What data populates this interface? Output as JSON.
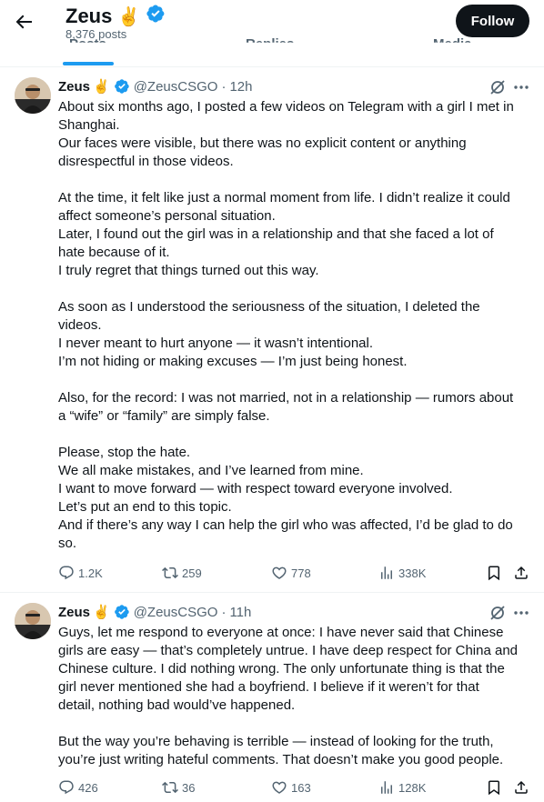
{
  "header": {
    "name": "Zeus",
    "name_emoji": "✌️",
    "posts_count": "8,376 posts",
    "follow_label": "Follow",
    "tabs": [
      "Posts",
      "Replies",
      "Media"
    ]
  },
  "tweets": [
    {
      "name": "Zeus",
      "emoji": "✌️",
      "handle": "@ZeusCSGO",
      "time": "12h",
      "lines": [
        "About six months ago, I posted a few videos on Telegram with a girl I met in",
        "Shanghai.",
        "Our faces were visible, but there was no explicit content or anything",
        "disrespectful in those videos.",
        "",
        "At the time, it felt like just a normal moment from life. I didn’t realize it could",
        "affect someone’s personal situation.",
        "Later, I found out the girl was in a relationship and that she faced a lot of",
        "hate because of it.",
        "I truly regret that things turned out this way.",
        "",
        "As soon as I understood the seriousness of the situation, I deleted the",
        "videos.",
        "I never meant to hurt anyone — it wasn’t intentional.",
        "I’m not hiding or making excuses — I’m just being honest.",
        "",
        "Also, for the record: I was not married, not in a relationship — rumors about",
        "a “wife” or “family” are simply false.",
        "",
        "Please, stop the hate.",
        "We all make mistakes, and I’ve learned from mine.",
        "I want to move forward — with respect toward everyone involved.",
        "Let’s put an end to this topic.",
        "And if there’s any way I can help the girl who was affected, I’d be glad to do",
        "so."
      ],
      "replies": "1.2K",
      "reposts": "259",
      "likes": "778",
      "views": "338K"
    },
    {
      "name": "Zeus",
      "emoji": "✌️",
      "handle": "@ZeusCSGO",
      "time": "11h",
      "lines": [
        "Guys, let me respond to everyone at once: I have never said that Chinese",
        "girls are easy — that’s completely untrue. I have deep respect for China and",
        "Chinese culture. I did nothing wrong. The only unfortunate thing is that the",
        "girl never mentioned she had a boyfriend. I believe if it weren’t for that",
        "detail, nothing bad would’ve happened.",
        "",
        "But the way you’re behaving is terrible — instead of looking for the truth,",
        "you’re just writing hateful comments. That doesn’t make you good people."
      ],
      "replies": "426",
      "reposts": "36",
      "likes": "163",
      "views": "128K"
    }
  ],
  "colors": {
    "accent": "#1d9bf0",
    "text": "#0f1419",
    "muted": "#536471",
    "follow_bg": "#0f1419"
  }
}
